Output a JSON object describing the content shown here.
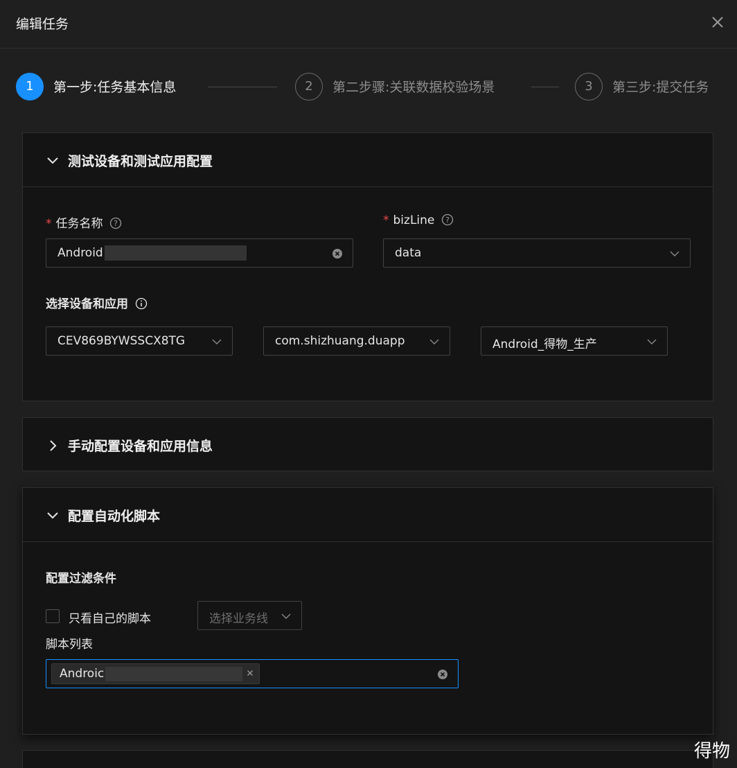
{
  "modal": {
    "title": "编辑任务"
  },
  "steps": [
    {
      "number": "1",
      "label": "第一步:任务基本信息"
    },
    {
      "number": "2",
      "label": "第二步骤:关联数据校验场景"
    },
    {
      "number": "3",
      "label": "第三步:提交任务"
    }
  ],
  "panel_device": {
    "title": "测试设备和测试应用配置",
    "task_name_label": "任务名称",
    "task_name_value": "Android",
    "bizline_label": "bizLine",
    "bizline_value": "data",
    "select_label": "选择设备和应用",
    "device_value": "CEV869BYWSSCX8TG",
    "package_value": "com.shizhuang.duapp",
    "env_value": "Android_得物_生产"
  },
  "panel_manual": {
    "title": "手动配置设备和应用信息"
  },
  "panel_script": {
    "title": "配置自动化脚本",
    "filter_label": "配置过滤条件",
    "only_mine_label": "只看自己的脚本",
    "bizline_select_placeholder": "选择业务线",
    "script_list_label": "脚本列表",
    "script_tag_value": "Androic"
  },
  "watermark": "得物",
  "colors": {
    "accent": "#1890ff",
    "required": "#e84749",
    "background": "#1f1f1f",
    "panel": "#141414"
  }
}
